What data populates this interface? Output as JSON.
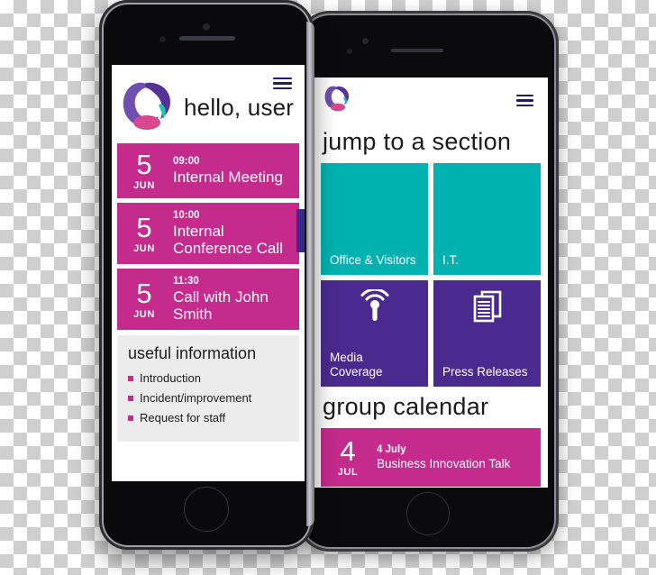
{
  "meta": {
    "colors": {
      "magenta": "#c52a8d",
      "teal": "#00b2af",
      "purple": "#4a2a8e",
      "navy": "#241a5e",
      "divider_pink": "#d98ab8",
      "grey_panel": "#ececec"
    }
  },
  "front_phone": {
    "header": {
      "logo_icon": "brand-logo-icon",
      "menu_icon": "hamburger-menu-icon",
      "greeting": "hello, user"
    },
    "events": [
      {
        "day": "5",
        "month": "JUN",
        "time": "09:00",
        "title": "Internal Meeting"
      },
      {
        "day": "5",
        "month": "JUN",
        "time": "10:00",
        "title": "Internal Conference Call"
      },
      {
        "day": "5",
        "month": "JUN",
        "time": "11:30",
        "title": "Call with John Smith"
      }
    ],
    "useful_information": {
      "heading": "useful information",
      "links": [
        "Introduction",
        "Incident/improvement",
        "Request for staff"
      ]
    }
  },
  "back_phone": {
    "header": {
      "logo_icon": "brand-logo-icon",
      "menu_icon": "hamburger-menu-icon"
    },
    "jump_section": {
      "title": "jump to a section",
      "tiles": [
        {
          "label": "Office & Visitors",
          "color": "teal",
          "icon": ""
        },
        {
          "label": "I.T.",
          "color": "teal",
          "icon": ""
        },
        {
          "label": "Media Coverage",
          "color": "purple",
          "icon": "broadcast-antenna-icon"
        },
        {
          "label": "Press Releases",
          "color": "purple",
          "icon": "documents-stack-icon"
        }
      ]
    },
    "group_calendar": {
      "title": "group calendar",
      "events": [
        {
          "day": "4",
          "month": "JUL",
          "date_label": "4 July",
          "title": "Business Innovation Talk"
        }
      ]
    }
  }
}
